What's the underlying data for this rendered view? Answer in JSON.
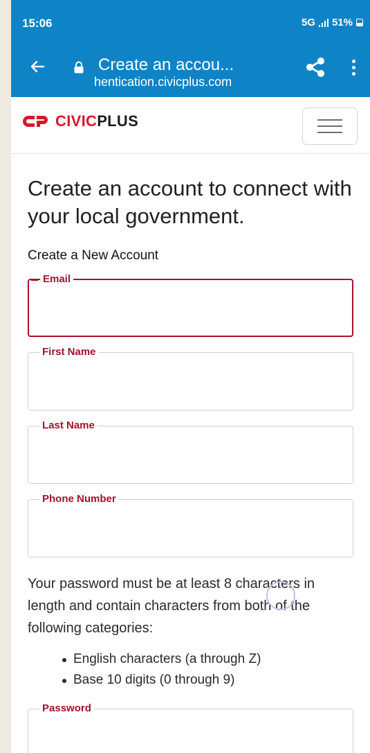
{
  "status_bar": {
    "time": "15:06",
    "network": "5G",
    "battery": "51%"
  },
  "browser": {
    "page_title": "Create an accou...",
    "host": "hentication.civicplus.com"
  },
  "site": {
    "logo_text_brand": "CIVIC",
    "logo_text_dark": "PLUS",
    "brand_color": "#d6182b"
  },
  "form": {
    "headline": "Create an account to connect with your local government.",
    "subhead": "Create a New Account",
    "fields": [
      {
        "label": "Email",
        "value": ""
      },
      {
        "label": "First Name",
        "value": ""
      },
      {
        "label": "Last Name",
        "value": ""
      },
      {
        "label": "Phone Number",
        "value": ""
      }
    ],
    "password_rules_text": "Your password must be at least 8 characters in length and contain characters from both of the following categories:",
    "password_rules": [
      "English characters (a through Z)",
      "Base 10 digits (0 through 9)"
    ],
    "password_label": "Password"
  },
  "colors": {
    "toolbar": "#0e84c7",
    "field_accent": "#a3122d"
  }
}
